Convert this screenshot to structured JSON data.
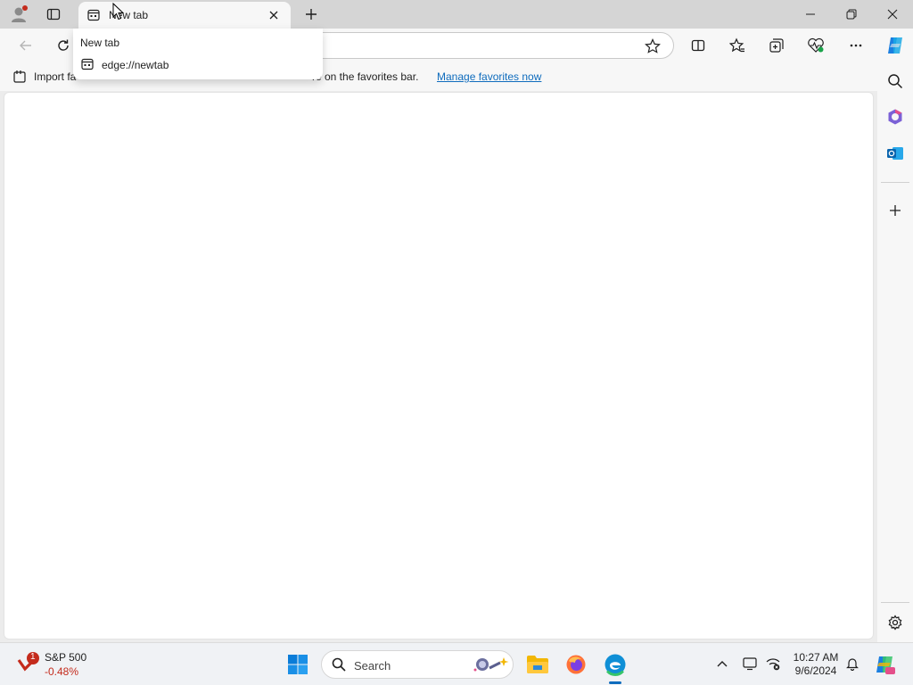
{
  "tab": {
    "title": "New tab"
  },
  "tab_popup": {
    "title": "New tab",
    "url": "edge://newtab"
  },
  "favorites_bar": {
    "import_prefix": "Import fa",
    "message_suffix": "re on the favorites bar.",
    "manage_link": "Manage favorites now"
  },
  "taskbar": {
    "widget": {
      "name": "S&P 500",
      "change": "-0.48%",
      "badge": "1"
    },
    "search_label": "Search",
    "clock": {
      "time": "10:27 AM",
      "date": "9/6/2024"
    }
  },
  "colors": {
    "accent": "#0f6cbd",
    "negative": "#c42b1c",
    "titlebar": "#d5d5d5",
    "toolbar": "#f7f7f7"
  },
  "icons": [
    "profile-icon",
    "tab-actions-icon",
    "page-icon",
    "close-icon",
    "plus-icon",
    "minimize-icon",
    "restore-icon",
    "back-icon",
    "refresh-icon",
    "star-icon",
    "split-screen-icon",
    "favorites-icon",
    "collections-icon",
    "performance-icon",
    "more-icon",
    "copilot-icon",
    "search-icon",
    "office-icon",
    "outlook-icon",
    "settings-icon",
    "windows-start-icon",
    "file-explorer-icon",
    "firefox-icon",
    "edge-icon",
    "chevron-up-icon",
    "notification-icon"
  ]
}
